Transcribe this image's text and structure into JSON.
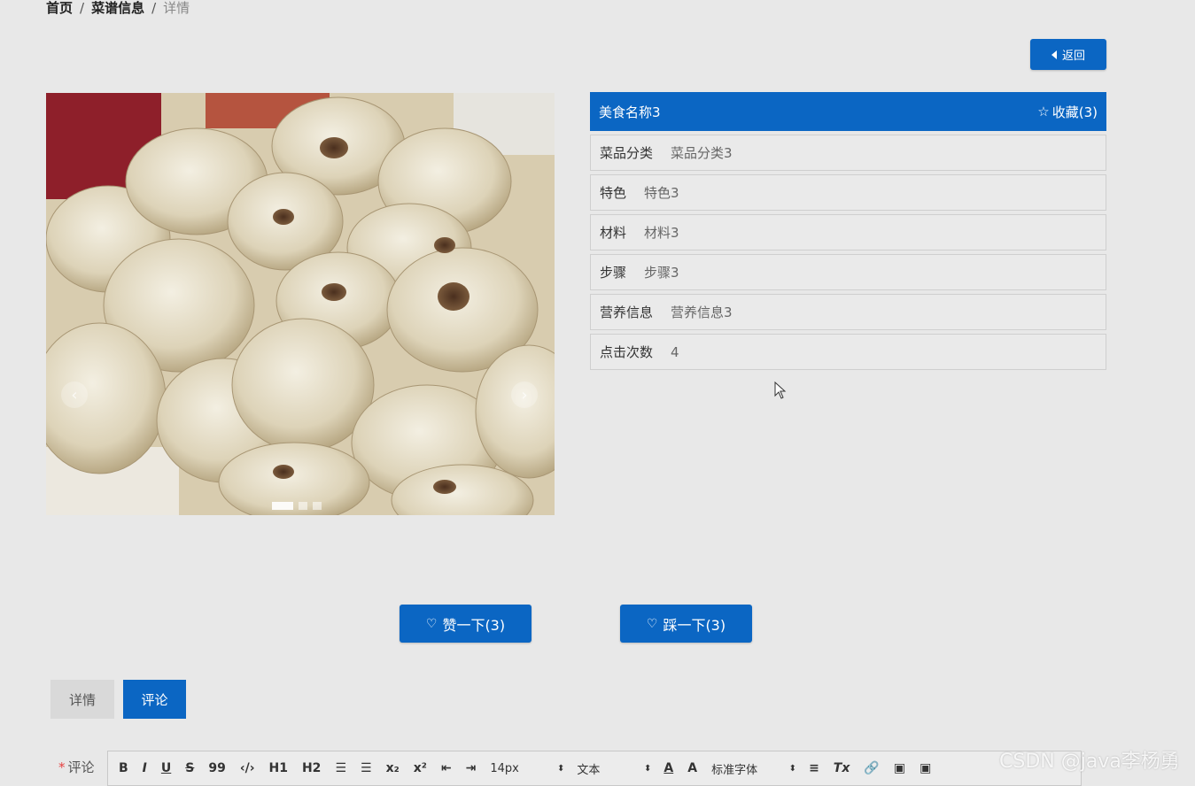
{
  "breadcrumb": {
    "home": "首页",
    "sep1": "/",
    "section": "菜谱信息",
    "sep2": "/",
    "current": "详情"
  },
  "back_button": {
    "label": "返回"
  },
  "carousel": {
    "prev_icon": "‹",
    "next_icon": "›",
    "slide_count": 3,
    "active_slide": 1
  },
  "info": {
    "name": "美食名称3",
    "favorite": {
      "star": "☆",
      "label": "收藏(3)"
    },
    "rows": [
      {
        "key": "菜品分类",
        "value": "菜品分类3"
      },
      {
        "key": "特色",
        "value": "特色3"
      },
      {
        "key": "材料",
        "value": "材料3"
      },
      {
        "key": "步骤",
        "value": "步骤3"
      },
      {
        "key": "营养信息",
        "value": "营养信息3"
      },
      {
        "key": "点击次数",
        "value": "4"
      }
    ]
  },
  "votes": {
    "up_label": "赞一下(3)",
    "down_label": "踩一下(3)"
  },
  "tabs": {
    "detail": "详情",
    "comment": "评论"
  },
  "comment": {
    "required_mark": "*",
    "label": "评论"
  },
  "editor_toolbar": {
    "bold": "B",
    "italic": "I",
    "underline": "U",
    "strike": "S",
    "quote": "99",
    "code": "‹/›",
    "h1": "H1",
    "h2": "H2",
    "ordered_list": "☰",
    "bullet_list": "☰",
    "subscript": "x₂",
    "superscript": "x²",
    "outdent": "⇤",
    "indent": "⇥",
    "size": "14px",
    "text_style": "文本",
    "color": "A",
    "background": "A",
    "font": "标准字体",
    "align": "≡",
    "clear": "Tx",
    "link": "🔗",
    "image": "▣",
    "video": "▣"
  },
  "watermark": "CSDN @java李杨勇",
  "colors": {
    "primary": "#0b66c3",
    "background": "#e8e8e8"
  }
}
